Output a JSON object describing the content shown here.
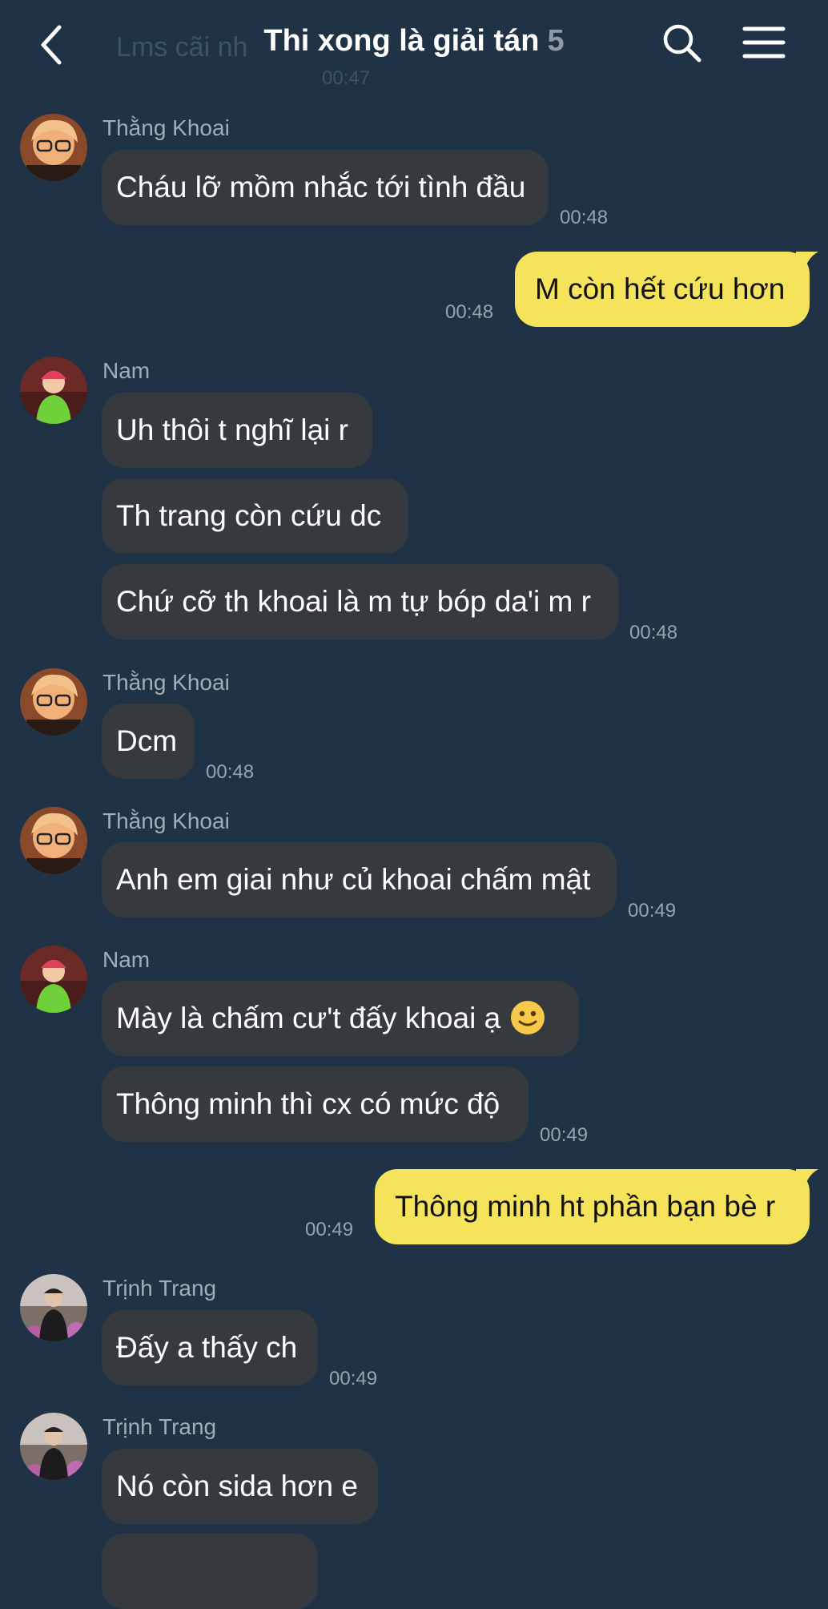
{
  "header": {
    "title": "Thi xong là giải tán",
    "member_count": "5",
    "behind_message": "Lms cãi nh",
    "behind_time": "00:47",
    "back_icon": "chevron-left-icon",
    "search_icon": "search-icon",
    "menu_icon": "hamburger-menu-icon"
  },
  "messages": [
    {
      "sender": "Thằng Khoai",
      "text": "Cháu lỡ mồm nhắc tới tình đầu",
      "time": "00:48"
    },
    {
      "mine": true,
      "text": "M còn hết cứu hơn",
      "time": "00:48"
    },
    {
      "sender": "Nam",
      "text": "Uh thôi t nghĩ lại r"
    },
    {
      "text": "Th trang còn cứu dc"
    },
    {
      "text": "Chứ cỡ th khoai là m tự bóp da'i m r",
      "time": "00:48"
    },
    {
      "sender": "Thằng Khoai",
      "text": "Dcm",
      "time": "00:48"
    },
    {
      "sender": "Thằng Khoai",
      "text": "Anh em giai như củ khoai chấm mật",
      "time": "00:49"
    },
    {
      "sender": "Nam",
      "text": "Mày là chấm cư't đấy khoai ạ",
      "emoji": "slightly-smiling-face-emoji"
    },
    {
      "text": "Thông minh thì cx có mức độ",
      "time": "00:49"
    },
    {
      "mine": true,
      "text": "Thông minh ht phần bạn bè r",
      "time": "00:49"
    },
    {
      "sender": "Trịnh Trang",
      "text": "Đấy a thấy ch",
      "time": "00:49"
    },
    {
      "sender": "Trịnh Trang",
      "text": "Nó còn sida hơn e"
    }
  ],
  "colors": {
    "background": "#1f3246",
    "incoming_bubble": "#363a3f",
    "outgoing_bubble": "#f5e35b",
    "timestamp": "#98a3ad"
  }
}
